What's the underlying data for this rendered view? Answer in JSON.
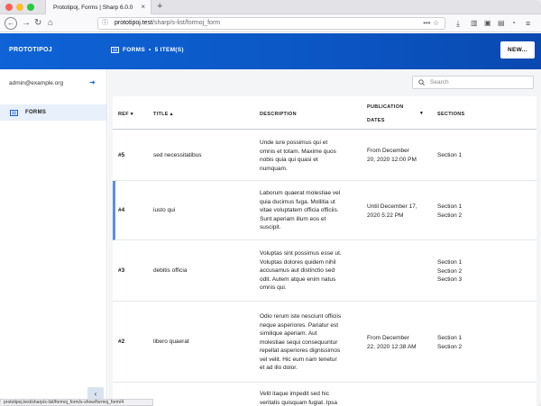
{
  "browser": {
    "tab_title": "Prototipoj, Forms | Sharp 6.0.0",
    "url_host": "prototipoj.test",
    "url_path": "/sharp/s-list/formoj_form",
    "status_url": "prototipoj.test/sharp/s-list/formoj_form/s-show/formoj_form/4"
  },
  "app": {
    "brand": "PROTOTIPOJ",
    "breadcrumb": "FORMS",
    "breadcrumb_sep": "•",
    "item_count": "5 ITEM(S)",
    "new_label": "NEW..."
  },
  "sidebar": {
    "user_email": "admin@example.org",
    "items": [
      {
        "label": "FORMS"
      }
    ]
  },
  "search": {
    "placeholder": "Search"
  },
  "table": {
    "columns": {
      "ref": "REF",
      "title": "TITLE",
      "description": "DESCRIPTION",
      "pub_line1": "PUBLICATION",
      "pub_line2": "DATES",
      "sections": "SECTIONS"
    },
    "rows": [
      {
        "ref": "#5",
        "title": "sed necessitatibus",
        "desc": [
          "Unde iure possimus qui et",
          "omnis et totam. Maxime quos",
          "nobis quia qui quasi et",
          "numquam."
        ],
        "pub": [
          "From December",
          "20, 2020 12:00 PM"
        ],
        "sections": [
          "Section 1"
        ]
      },
      {
        "ref": "#4",
        "title": "iusto qui",
        "desc": [
          "Laborum quaerat molestiae vel",
          "quia ducimus fuga. Mollitia ut",
          "vitae voluptatem officia officiis.",
          "Sunt aperiam illum eos et",
          "suscipit."
        ],
        "pub": [
          "Until December 17,",
          "2020 5:22 PM"
        ],
        "sections": [
          "Section 1",
          "Section 2"
        ]
      },
      {
        "ref": "#3",
        "title": "debitis officia",
        "desc": [
          "Voluptas sint possimus esse ut.",
          "Voluptas dolores quidem nihil",
          "accusamus aut distinctio sed",
          "odit. Autem atque enim natus",
          "omnis qui."
        ],
        "pub": [],
        "sections": [
          "Section 1",
          "Section 2",
          "Section 3"
        ]
      },
      {
        "ref": "#2",
        "title": "libero quaerat",
        "desc": [
          "Odio rerum iste nesciunt officiis",
          "neque asperiores. Pariatur est",
          "similique aperiam. Aut",
          "molestiae sequi consequuntur",
          "repellat asperiores dignissimos",
          "vel velit. Hic eum nam tenetur",
          "et ad illo dolor."
        ],
        "pub": [
          "From December",
          "22, 2020 12:38 AM"
        ],
        "sections": [
          "Section 1",
          "Section 2"
        ]
      },
      {
        "ref": "",
        "title": "",
        "desc": [
          "Velit itaque impedit sed hic",
          "veritatis quisquam fugiat. Ipsa"
        ],
        "pub": [],
        "sections": []
      }
    ]
  },
  "colors": {
    "accent": "#0f63d6",
    "selected_row_bar": "#5b8fe0",
    "sidebar_active": "#e8f0fb"
  }
}
